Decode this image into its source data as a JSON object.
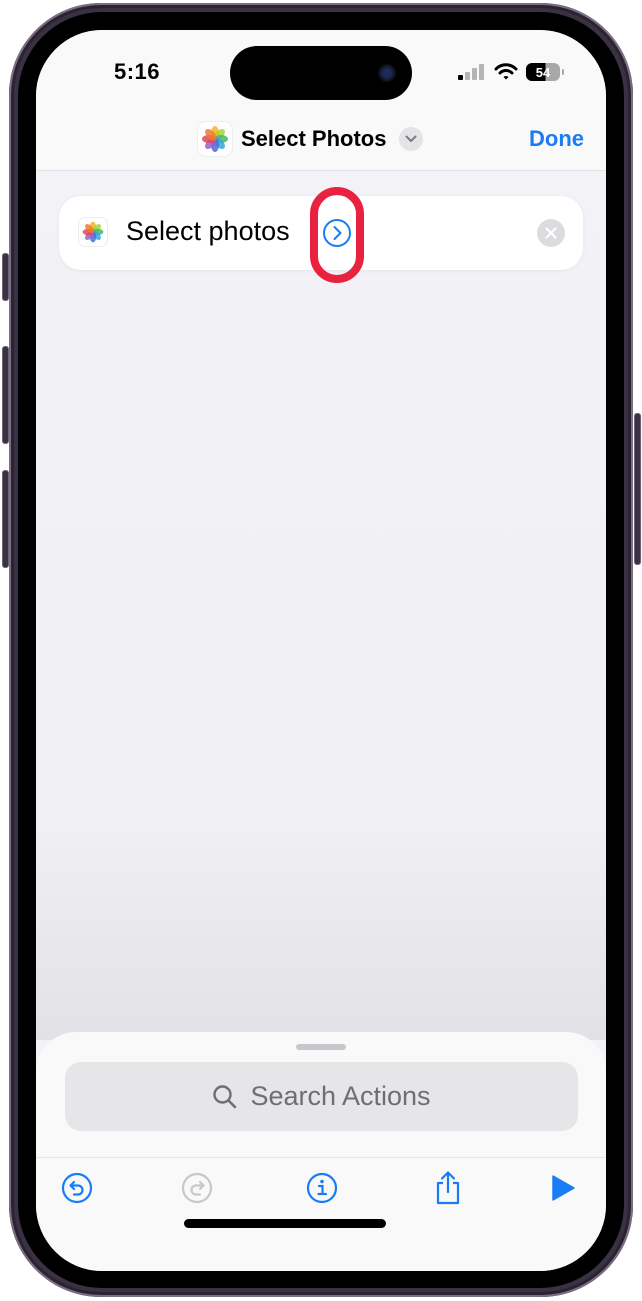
{
  "status_bar": {
    "time": "5:16",
    "battery_level": "54",
    "signal_icon": "cellular-signal-icon",
    "wifi_icon": "wifi-icon"
  },
  "header": {
    "title": "Select Photos",
    "app_icon": "photos-app-icon",
    "menu_icon": "chevron-down-icon",
    "done_label": "Done"
  },
  "action": {
    "label": "Select photos",
    "expand_icon": "chevron-right-circle-icon",
    "remove_icon": "close-circle-icon"
  },
  "bottom_sheet": {
    "search_placeholder": "Search Actions",
    "search_icon": "magnifying-glass-icon"
  },
  "toolbar": {
    "buttons": [
      {
        "name": "undo",
        "icon": "undo-icon",
        "enabled": true
      },
      {
        "name": "redo",
        "icon": "redo-icon",
        "enabled": false
      },
      {
        "name": "info",
        "icon": "info-icon",
        "enabled": true
      },
      {
        "name": "share",
        "icon": "share-icon",
        "enabled": true
      },
      {
        "name": "run",
        "icon": "play-icon",
        "enabled": true
      }
    ]
  },
  "colors": {
    "accent": "#1a7cf5",
    "highlight": "#e8223f",
    "disabled": "#c7c7cc"
  }
}
